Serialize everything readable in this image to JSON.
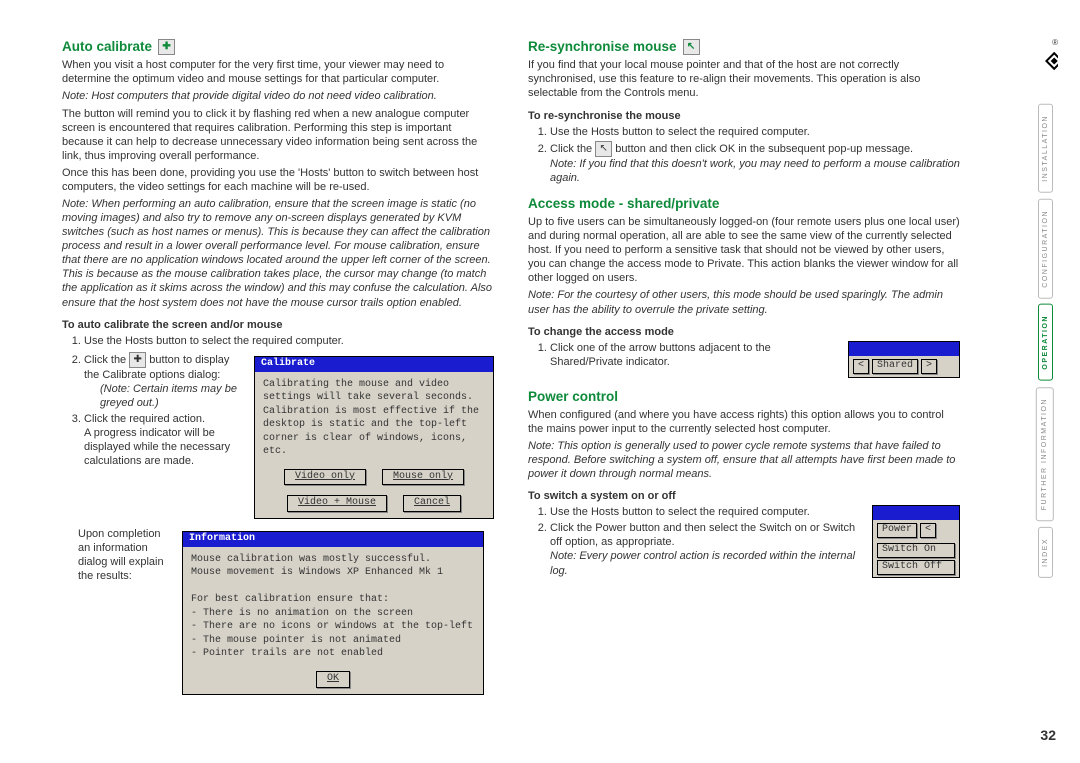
{
  "page_number": "32",
  "sidebar": {
    "tabs": [
      "INSTALLATION",
      "CONFIGURATION",
      "OPERATION",
      "FURTHER INFORMATION",
      "INDEX"
    ],
    "active": "OPERATION"
  },
  "left": {
    "h_auto": "Auto calibrate",
    "p1": "When you visit a host computer for the very first time, your viewer may need to determine the optimum video and mouse settings for that particular computer.",
    "p2_note": "Note: Host computers that provide digital video do not need video calibration.",
    "p3": "The button will remind you to click it by flashing red when a new analogue computer screen is encountered that requires calibration. Performing this step is important because it can help to decrease unnecessary video information being sent across the link, thus improving overall performance.",
    "p4": "Once this has been done, providing you use the 'Hosts' button to switch between host computers, the video settings for each machine will be re-used.",
    "p5_note": "Note: When performing an auto calibration, ensure that the screen image is static (no moving images) and also try to remove any on-screen displays generated by KVM switches (such as host names or menus). This is because they can affect the calibration process and result in a lower overall performance level. For mouse calibration, ensure that there are no application windows located around the upper left corner of the screen. This is because as the mouse calibration takes place, the cursor may change (to match the application as it skims across the window) and this may confuse the calculation. Also ensure that the host system does not have the mouse cursor trails option enabled.",
    "h3_auto": "To auto calibrate the screen and/or mouse",
    "li1": "Use the Hosts button to select the required computer.",
    "li2a": "Click the ",
    "li2b": " button to display the Calibrate options dialog:",
    "li2_note": "(Note: Certain items may be greyed out.)",
    "li3": "Click the required action.",
    "li3_p": "A progress indicator will be displayed while the necessary calculations are made.",
    "li_after": "Upon completion an information dialog will explain the results:",
    "dlg1": {
      "title": "Calibrate",
      "body": "Calibrating the mouse and video settings will take several seconds. Calibration is most effective if the desktop is static and the top-left corner is clear of windows, icons, etc.",
      "btn1": "Video only",
      "btn2": "Mouse only",
      "btn3": "Video + Mouse",
      "btn4": "Cancel"
    },
    "dlg2": {
      "title": "Information",
      "l1": "Mouse calibration was mostly successful.",
      "l2": "Mouse movement is Windows XP Enhanced Mk 1",
      "l3": "For best calibration ensure that:",
      "b1": "- There is no animation on the screen",
      "b2": "- There are no icons or windows at the top-left",
      "b3": "- The mouse pointer is not animated",
      "b4": "- Pointer trails are not enabled",
      "ok": "OK"
    }
  },
  "right": {
    "h_resync": "Re-synchronise mouse",
    "p_resync": "If you find that your local mouse pointer and that of the host are not correctly synchronised, use this feature to re-align their movements. This operation is also selectable from the Controls menu.",
    "h3_resync": "To re-synchronise the mouse",
    "rli1": "Use the Hosts button to select the required computer.",
    "rli2a": "Click the ",
    "rli2b": " button and then click OK in the subsequent pop-up message.",
    "rli2_note": "Note: If you find that this doesn't work, you may need to perform a mouse calibration again.",
    "h_access": "Access mode - shared/private",
    "p_access": "Up to five users can be simultaneously logged-on (four remote users plus one local user) and during normal operation, all are able to see the same view of the currently selected host. If you need to perform a sensitive task that should not be viewed by other users, you can change the access mode to Private. This action blanks the viewer window for all other logged on users.",
    "p_access_note": "Note: For the courtesy of other users, this mode should be used sparingly. The admin user has the ability to overrule the private setting.",
    "h3_access": "To change the access mode",
    "ali1": "Click one of the arrow buttons adjacent to the Shared/Private indicator.",
    "shared_label": "Shared",
    "h_power": "Power control",
    "p_power": "When configured (and where you have access rights) this option allows you to control the mains power input to the currently selected host computer.",
    "p_power_note": "Note: This option is generally used to power cycle remote systems that have failed to respond. Before switching a system off, ensure that all attempts have first been made to power it down through normal means.",
    "h3_power": "To switch a system on or off",
    "pli1": "Use the Hosts button to select the required computer.",
    "pli2": "Click the Power button and then select the Switch on or Switch off option, as appropriate.",
    "pli2_note": "Note: Every power control action is recorded within the internal log.",
    "power_menu": {
      "btn": "Power",
      "on": "Switch On",
      "off": "Switch Off"
    }
  }
}
